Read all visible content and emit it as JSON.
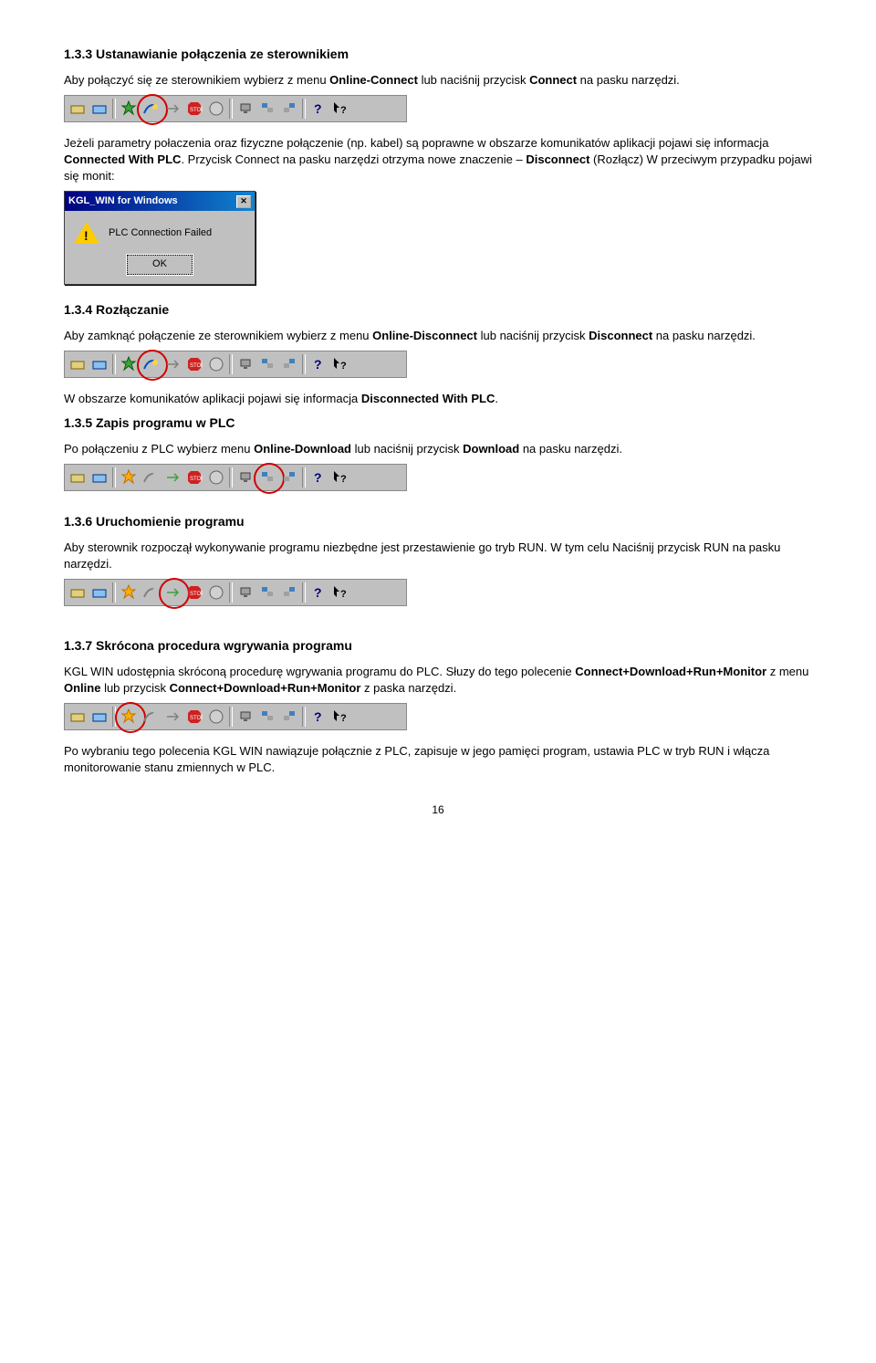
{
  "section1": {
    "heading": "1.3.3 Ustanawianie połączenia ze sterownikiem",
    "p1_a": "Aby połączyć się ze sterownikiem wybierz z menu ",
    "p1_b": "Online-Connect",
    "p1_c": " lub naciśnij przycisk ",
    "p1_d": "Connect",
    "p1_e": " na pasku narzędzi.",
    "p2_a": "Jeżeli parametry połaczenia oraz fizyczne połączenie (np. kabel) są poprawne w obszarze komunikatów aplikacji pojawi się informacja ",
    "p2_b": "Connected With PLC",
    "p2_c": ". Przycisk Connect na pasku narzędzi otrzyma nowe znaczenie – ",
    "p2_d": "Disconnect",
    "p2_e": " (Rozłącz) W przeciwym przypadku pojawi się monit:"
  },
  "dialog": {
    "title": "KGL_WIN for Windows",
    "message": "PLC Connection Failed",
    "ok": "OK"
  },
  "section2": {
    "heading": "1.3.4 Rozłączanie",
    "p1_a": "Aby zamknąć połączenie ze sterownikiem wybierz z menu ",
    "p1_b": "Online-Disconnect",
    "p1_c": " lub naciśnij przycisk ",
    "p1_d": "Disconnect",
    "p1_e": " na pasku narzędzi.",
    "p2_a": "W obszarze komunikatów aplikacji pojawi się informacja ",
    "p2_b": "Disconnected With PLC",
    "p2_c": "."
  },
  "section3": {
    "heading": "1.3.5 Zapis programu w PLC",
    "p1_a": "Po połączeniu z PLC wybierz  menu ",
    "p1_b": "Online-Download",
    "p1_c": " lub naciśnij przycisk ",
    "p1_d": "Download",
    "p1_e": " na pasku narzędzi."
  },
  "section4": {
    "heading": "1.3.6 Uruchomienie programu",
    "p1": "Aby sterownik rozpoczął wykonywanie programu niezbędne jest przestawienie go tryb RUN. W tym celu Naciśnij przycisk RUN na pasku narzędzi."
  },
  "section5": {
    "heading": "1.3.7 Skrócona procedura wgrywania programu",
    "p1_a": "KGL WIN udostępnia skróconą procedurę wgrywania programu do PLC. Słuzy do tego polecenie ",
    "p1_b": "Connect+Download+Run+Monitor",
    "p1_c": " z menu ",
    "p1_d": "Online",
    "p1_e": " lub przycisk ",
    "p1_f": "Connect+Download+Run+Monitor",
    "p1_g": " z paska narzędzi.",
    "p2": "Po wybraniu tego polecenia KGL WIN nawiązuje połącznie z PLC, zapisuje w jego pamięci program, ustawia PLC w tryb RUN i włącza monitorowanie stanu zmiennych w PLC."
  },
  "pageNumber": "16"
}
